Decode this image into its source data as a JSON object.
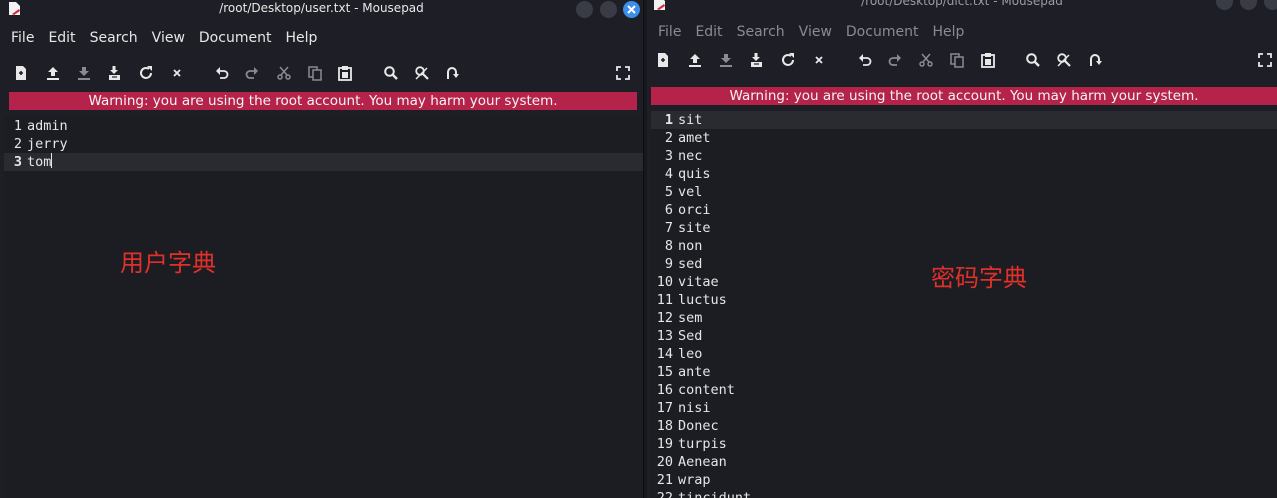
{
  "left_window": {
    "title": "/root/Desktop/user.txt - Mousepad",
    "menu": [
      "File",
      "Edit",
      "Search",
      "View",
      "Document",
      "Help"
    ],
    "warning": "Warning: you are using the root account. You may harm your system.",
    "lines": [
      "admin",
      "jerry",
      "tom"
    ],
    "current_line": 3,
    "annotation": "用户字典"
  },
  "right_window": {
    "title": "/root/Desktop/dict.txt - Mousepad",
    "menu": [
      "File",
      "Edit",
      "Search",
      "View",
      "Document",
      "Help"
    ],
    "warning": "Warning: you are using the root account. You may harm your system.",
    "lines": [
      "sit",
      "amet",
      "nec",
      "quis",
      "vel",
      "orci",
      "site",
      "non",
      "sed",
      "vitae",
      "luctus",
      "sem",
      "Sed",
      "leo",
      "ante",
      "content",
      "nisi",
      "Donec",
      "turpis",
      "Aenean",
      "wrap",
      "tincidunt"
    ],
    "current_line": 1,
    "annotation": "密码字典"
  },
  "toolbar_icons": [
    "new-document-icon",
    "open-icon",
    "save-icon",
    "save-as-icon",
    "reload-icon",
    "close-icon",
    "undo-icon",
    "redo-icon",
    "cut-icon",
    "copy-icon",
    "paste-icon",
    "find-icon",
    "find-replace-icon",
    "goto-line-icon",
    "fullscreen-icon"
  ],
  "colors": {
    "warning_bg": "#b5234a",
    "annotation": "#e0302a",
    "close_button": "#3d8ee8"
  }
}
